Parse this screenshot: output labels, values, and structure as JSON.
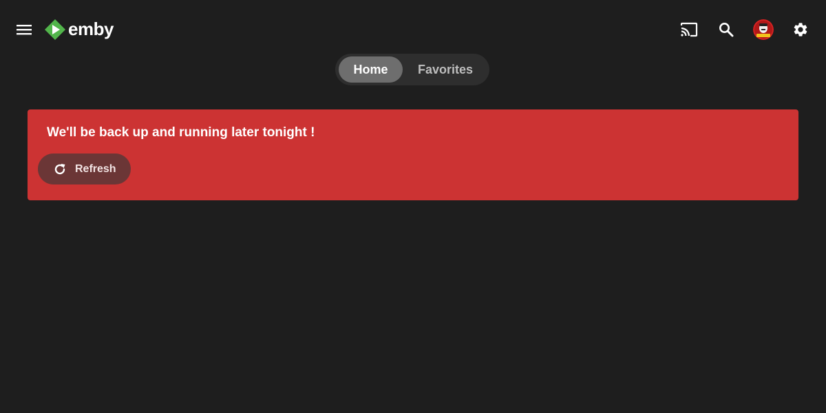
{
  "header": {
    "app_name": "emby",
    "icons": {
      "menu": "hamburger-menu-icon",
      "logo": "emby-logo-icon",
      "cast": "cast-icon",
      "search": "search-icon",
      "avatar": "user-avatar",
      "settings": "gear-icon"
    }
  },
  "tabs": [
    {
      "label": "Home",
      "selected": true
    },
    {
      "label": "Favorites",
      "selected": false
    }
  ],
  "banner": {
    "message": "We'll be back up and running later tonight !",
    "refresh_label": "Refresh",
    "refresh_icon": "refresh-icon"
  },
  "colors": {
    "background": "#1e1e1e",
    "accent_green": "#52b54b",
    "banner_red": "#cc3333",
    "refresh_button": "#6b3636",
    "tab_track": "#2e2e2e",
    "tab_selected": "#6e6e6e"
  }
}
